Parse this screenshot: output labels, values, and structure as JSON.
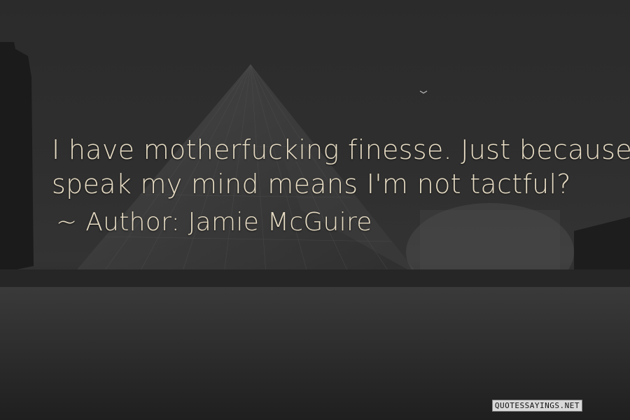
{
  "quote": {
    "lines": [
      "I have motherfucking finesse. Just because I",
      "speak my mind means I'm not tactful?"
    ],
    "author_line": "~ Author: Jamie McGuire"
  },
  "watermark": "QUOTESSAYINGS.NET",
  "background": {
    "description_icon": "louvre-pyramid-night-photo",
    "text_color": "#e7dcc4"
  }
}
